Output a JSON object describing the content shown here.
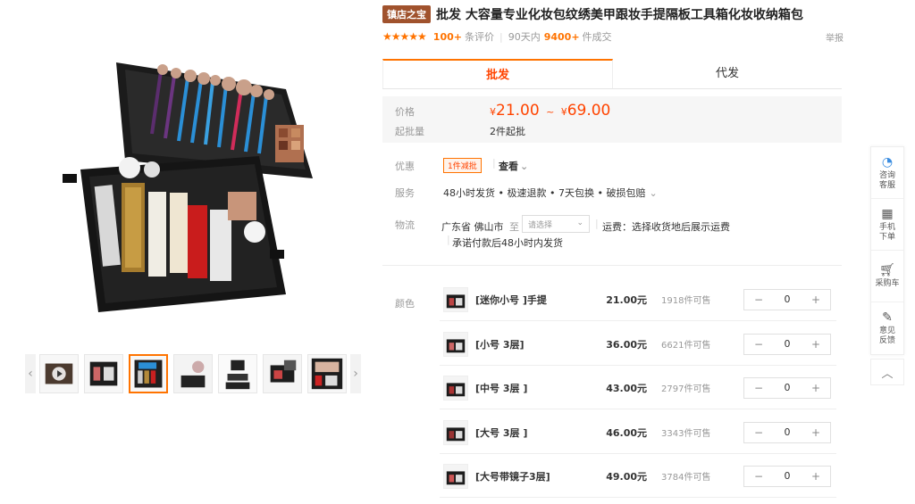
{
  "header": {
    "shop_badge": "镇店之宝",
    "title": "批发 大容量专业化妆包纹绣美甲跟妆手提隔板工具箱化妆收纳箱包",
    "stars": "★★★★★",
    "review_count": "100+",
    "review_label": "条评价",
    "period_label": "90天内",
    "sold_count": "9400+",
    "sold_label": "件成交",
    "report_label": "举报"
  },
  "tabs": [
    {
      "label": "批发",
      "active": true
    },
    {
      "label": "代发",
      "active": false
    }
  ],
  "price": {
    "label": "价格",
    "currency": "¥",
    "low": "21.00",
    "range_sep": "~",
    "high": "69.00",
    "moq_label": "起批量",
    "moq_value": "2件起批"
  },
  "promo": {
    "label": "优惠",
    "tag": "1件减批",
    "view_label": "查看",
    "chev": "⌄"
  },
  "service": {
    "label": "服务",
    "value": "48小时发货 • 极速退款 • 7天包换 • 破损包赔",
    "chev": "⌄"
  },
  "logistics": {
    "label": "物流",
    "origin": "广东省 佛山市",
    "to_label": "至",
    "select_placeholder": "请选择",
    "freight": "运费：选择收货地后展示运费",
    "promise": "承诺付款后48小时内发货"
  },
  "sku": {
    "label": "颜色",
    "items": [
      {
        "name": "[迷你小号 ]手提",
        "price": "21.00元",
        "sold": "1918件可售",
        "qty": "0"
      },
      {
        "name": "[小号 3层]",
        "price": "36.00元",
        "sold": "6621件可售",
        "qty": "0"
      },
      {
        "name": "[中号 3层 ]",
        "price": "43.00元",
        "sold": "2797件可售",
        "qty": "0"
      },
      {
        "name": "[大号 3层 ]",
        "price": "46.00元",
        "sold": "3343件可售",
        "qty": "0"
      },
      {
        "name": "[大号带镜子3层]",
        "price": "49.00元",
        "sold": "3784件可售",
        "qty": "0"
      }
    ],
    "minus": "−",
    "plus": "+"
  },
  "gallery": {
    "prev": "‹",
    "next": "›",
    "thumb_count": 7,
    "selected_index": 2
  },
  "sidebar": {
    "items": [
      {
        "label": "咨询客服",
        "icon": "chat-icon"
      },
      {
        "label": "手机下单",
        "icon": "qrcode-icon"
      },
      {
        "label": "采购车",
        "icon": "cart-icon"
      },
      {
        "label": "意见反馈",
        "icon": "feedback-icon"
      }
    ],
    "top_icon": "chevron-up-icon"
  },
  "colors": {
    "accent": "#ff7300",
    "price": "#ff4400",
    "badge": "#a0522d"
  }
}
